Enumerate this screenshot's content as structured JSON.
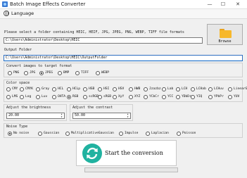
{
  "window": {
    "title": "Batch Image Effects Converter",
    "minimize_glyph": "—",
    "maximize_glyph": "☐",
    "close_glyph": "✕"
  },
  "menu": {
    "language_label": "Language"
  },
  "input": {
    "label": "Please select a folder containing HEIC, HEIF, JPG, JPEG, PNG, WEBP, TIFF file formats",
    "value": "C:\\Users\\Administrator\\Desktop\\HEIC",
    "browse_label": "Browse",
    "browse_icon": "folder-icon"
  },
  "output": {
    "label": "Output Folder",
    "value": "C:\\Users\\Administrator\\Desktop\\HEIC\\OutputFolder"
  },
  "target_format": {
    "label": "Convert images to target format",
    "options": [
      "PNG",
      "JPG",
      "JPEG",
      "BMP",
      "TIFF",
      "WEBP"
    ],
    "selected": "JPEG"
  },
  "color_space": {
    "label": "Color space",
    "row1": [
      "CMY",
      "CMYK",
      "Gray",
      "HCL",
      "HCLp",
      "HSB",
      "HSI",
      "HSV",
      "HWB",
      "Jzazbz",
      "Lab",
      "LCH",
      "LCHab",
      "LCHuv",
      "LinearGray"
    ],
    "row2": [
      "LMS",
      "Log",
      "Luv",
      "OHTA",
      "RGB",
      "scRGB",
      "sRGB",
      "XyY",
      "XYZ",
      "YCbCr",
      "YCC",
      "YDbDr",
      "YIQ",
      "YPbPr",
      "YUV"
    ],
    "selected": "RGB"
  },
  "brightness": {
    "label": "Adjust the brightness",
    "value": "20.00"
  },
  "contrast": {
    "label": "Adjust the contrast",
    "value": "50.00"
  },
  "noise": {
    "label": "Noise Type",
    "options": [
      "No noise",
      "Gaussian",
      "MultiplicativeGaussian",
      "Impulse",
      "Laplacian",
      "Poisson"
    ],
    "selected": "No noise"
  },
  "start": {
    "label": "Start the conversion",
    "icon": "convert-icon"
  },
  "progress": {
    "fraction": 0.0
  },
  "colors": {
    "accent": "#0a64c8",
    "convert_icon": "#20b2a0",
    "folder": "#f7b82b"
  }
}
